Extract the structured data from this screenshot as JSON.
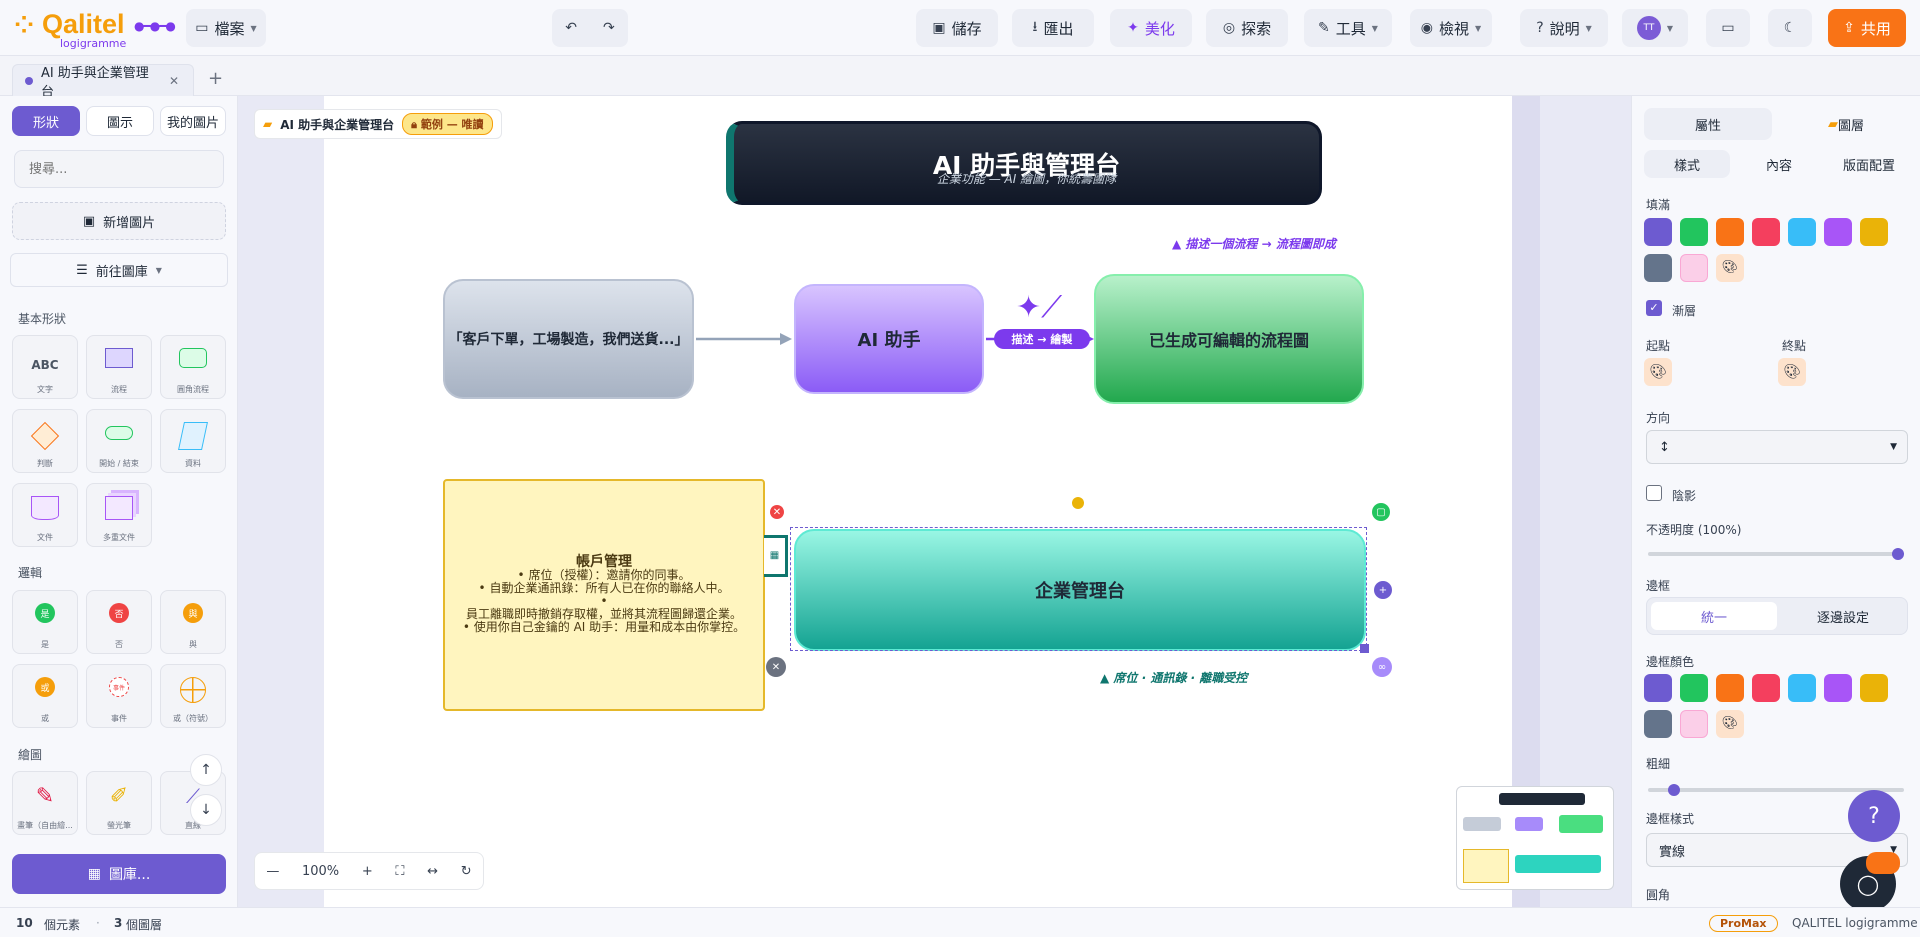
{
  "app": {
    "logo_name": "Qalitel",
    "logo_sub": "logigramme"
  },
  "toolbar": {
    "file": "檔案",
    "save": "儲存",
    "export": "匯出",
    "beautify": "美化",
    "explore": "探索",
    "tools": "工具",
    "view": "檢視",
    "help": "說明",
    "avatar": "TT",
    "share": "共用"
  },
  "tabs": {
    "active": "AI 助手與企業管理台"
  },
  "left": {
    "tabs": [
      "形狀",
      "圖示",
      "我的圖片"
    ],
    "search_placeholder": "搜尋...",
    "add_image": "新增圖片",
    "goto_gallery": "前往圖庫",
    "sections": {
      "basic": "基本形狀",
      "logic": "邏輯",
      "draw": "繪圖"
    },
    "basic_shapes": [
      "文字",
      "流程",
      "圓角流程",
      "判斷",
      "開始 / 結束",
      "資料",
      "文件",
      "多重文件"
    ],
    "basic_glyph_text": "ABC",
    "logic_shapes": [
      {
        "label": "是",
        "mark": "是",
        "color": "#22c55e"
      },
      {
        "label": "否",
        "mark": "否",
        "color": "#ef4444"
      },
      {
        "label": "與",
        "mark": "與",
        "color": "#f59e0b"
      },
      {
        "label": "或",
        "mark": "或",
        "color": "#f59e0b"
      },
      {
        "label": "事件",
        "mark": "事件",
        "color": "#ef4444"
      },
      {
        "label": "或（符號）",
        "mark": "",
        "color": "#f59e0b"
      }
    ],
    "draw_shapes": [
      "畫筆（自由繪...",
      "螢光筆",
      "直線"
    ],
    "gallery_button": "圖庫..."
  },
  "canvas": {
    "breadcrumb": "AI 助手與企業管理台",
    "badge": "範例 — 唯讀",
    "title": "AI 助手與管理台",
    "subtitle": "企業功能 — AI 繪圖，你統籌團隊",
    "note_top": "▲ 描述一個流程 → 流程圖即成",
    "customer_node": "「客戶下單，工場製造，我們送貨...」",
    "ai_node": "AI 助手",
    "arrow_label": "描述 → 繪製",
    "flow_node": "已生成可編輯的流程圖",
    "acct_title": "帳戶管理",
    "acct_lines": [
      "• 席位（授權）：邀請你的同事。",
      "• 自動企業通訊錄：所有人已在你的聯絡人中。",
      "•",
      "員工離職即時撤銷存取權，並將其流程圖歸還企業。",
      "• 使用你自己金鑰的 AI 助手：用量和成本由你掌控。"
    ],
    "admin_node": "企業管理台",
    "note_bottom": "▲ 席位 · 通訊錄 · 離職受控",
    "zoom": "100%"
  },
  "right": {
    "tabs": [
      "屬性",
      "圖層"
    ],
    "subtabs": [
      "樣式",
      "內容",
      "版面配置"
    ],
    "fill_label": "填滿",
    "gradient_label": "漸層",
    "start_label": "起點",
    "end_label": "終點",
    "direction_label": "方向",
    "direction_value": "↕",
    "shadow_label": "陰影",
    "opacity_label": "不透明度 (100%)",
    "opacity": 1.0,
    "border_label": "邊框",
    "border_modes": [
      "統一",
      "逐邊設定"
    ],
    "border_color_label": "邊框顏色",
    "thickness_label": "粗細",
    "border_style_label": "邊框樣式",
    "border_style_value": "實線",
    "radius_label": "圓角",
    "colors": [
      "#6d5bd0",
      "#22c55e",
      "#f97316",
      "#f43f5e",
      "#38bdf8",
      "#a855f7",
      "#eab308",
      "#64748b",
      "#fbcfe8"
    ]
  },
  "status": {
    "elements_count": "10",
    "elements_label": "個元素",
    "layers_count": "3",
    "layers_label": "個圖層",
    "plan": "ProMax",
    "brand": "QALITEL logigramme"
  }
}
